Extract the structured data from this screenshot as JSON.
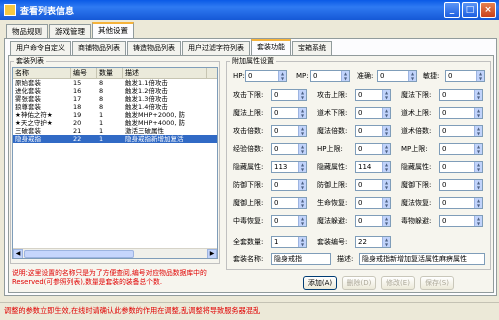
{
  "window": {
    "title": "查看列表信息"
  },
  "main_tabs": [
    {
      "label": "物品规则"
    },
    {
      "label": "游戏管理"
    },
    {
      "label": "其他设置"
    }
  ],
  "sub_tabs": [
    {
      "label": "用户命令自定义"
    },
    {
      "label": "商铺物品列表"
    },
    {
      "label": "铸造物品列表"
    },
    {
      "label": "用户过滤字符列表"
    },
    {
      "label": "套装功能"
    },
    {
      "label": "宝箱系统"
    }
  ],
  "list_group": {
    "title": "套装列表"
  },
  "list": {
    "columns": [
      "名称",
      "编号",
      "数量",
      "描述"
    ],
    "rows": [
      {
        "name": "原始套装",
        "id": "15",
        "count": "8",
        "desc": "触发1.1倍攻击"
      },
      {
        "name": "进化套装",
        "id": "16",
        "count": "8",
        "desc": "触发1.2倍攻击"
      },
      {
        "name": "雾张套装",
        "id": "17",
        "count": "8",
        "desc": "触发1.3倍攻击"
      },
      {
        "name": "狼尊套装",
        "id": "18",
        "count": "8",
        "desc": "触发1.4倍攻击"
      },
      {
        "name": "★神佑之符★",
        "id": "19",
        "count": "1",
        "desc": "触发MHP+2000, 防"
      },
      {
        "name": "★天之守护★",
        "id": "20",
        "count": "1",
        "desc": "触发MHP+4000, 防"
      },
      {
        "name": "三破套装",
        "id": "21",
        "count": "1",
        "desc": "激活三破属性"
      },
      {
        "name": "隐身戒指",
        "id": "22",
        "count": "1",
        "desc": "隐身戒指新增加复活"
      }
    ]
  },
  "attr_group": {
    "title": "附加属性设置"
  },
  "attrs": {
    "hp": {
      "label": "HP:",
      "value": "0"
    },
    "mp": {
      "label": "MP:",
      "value": "0"
    },
    "accuracy": {
      "label": "准确:",
      "value": "0"
    },
    "agility": {
      "label": "敏捷:",
      "value": "0"
    },
    "atk_min": {
      "label": "攻击下限:",
      "value": "0"
    },
    "atk_max": {
      "label": "攻击上限:",
      "value": "0"
    },
    "mag_min": {
      "label": "魔法下限:",
      "value": "0"
    },
    "mag_max": {
      "label": "魔法上限:",
      "value": "0"
    },
    "tao_min": {
      "label": "道术下限:",
      "value": "0"
    },
    "tao_max": {
      "label": "道术上限:",
      "value": "0"
    },
    "atk_mult": {
      "label": "攻击倍数:",
      "value": "0"
    },
    "mag_mult": {
      "label": "魔法倍数:",
      "value": "0"
    },
    "tao_mult": {
      "label": "道术倍数:",
      "value": "0"
    },
    "exp_mult": {
      "label": "经验倍数:",
      "value": "0"
    },
    "hp_max": {
      "label": "HP上限:",
      "value": "0"
    },
    "mp_max": {
      "label": "MP上限:",
      "value": "0"
    },
    "stealth1": {
      "label": "隐藏属性:",
      "value": "113"
    },
    "stealth2": {
      "label": "隐藏属性:",
      "value": "114"
    },
    "stealth3": {
      "label": "隐藏属性:",
      "value": "0"
    },
    "def_min": {
      "label": "防御下限:",
      "value": "0"
    },
    "def_max": {
      "label": "防御上限:",
      "value": "0"
    },
    "mdef_min": {
      "label": "魔御下限:",
      "value": "0"
    },
    "mdef_max": {
      "label": "魔御上限:",
      "value": "0"
    },
    "life_recover": {
      "label": "生命恢复:",
      "value": "0"
    },
    "magic_recover": {
      "label": "魔法恢复:",
      "value": "0"
    },
    "poison_recover": {
      "label": "中毒恢复:",
      "value": "0"
    },
    "magic_evade": {
      "label": "魔法躲避:",
      "value": "0"
    },
    "poison_evade": {
      "label": "毒物躲避:",
      "value": "0"
    },
    "set_count": {
      "label": "全套数量:",
      "value": "1"
    },
    "set_id": {
      "label": "套装编号:",
      "value": "22"
    }
  },
  "name_field": {
    "label": "套装名称:",
    "value": "隐身戒指"
  },
  "desc_field": {
    "label": "描述:",
    "value": "隐身戒指新增加复活属性麻痹属性"
  },
  "note": "说明:这里设置的名称只是为了方便查阅,编号对应物品数据库中的Reserved(可参照列表),数量是套装的装备总个数.",
  "buttons": {
    "add": "添加(A)",
    "delete": "删除(D)",
    "modify": "修改(E)",
    "save": "保存(S)"
  },
  "status": "调整的参数立即生效,在线时请确认此参数的作用在调整,乱调整将导致服务器混乱"
}
